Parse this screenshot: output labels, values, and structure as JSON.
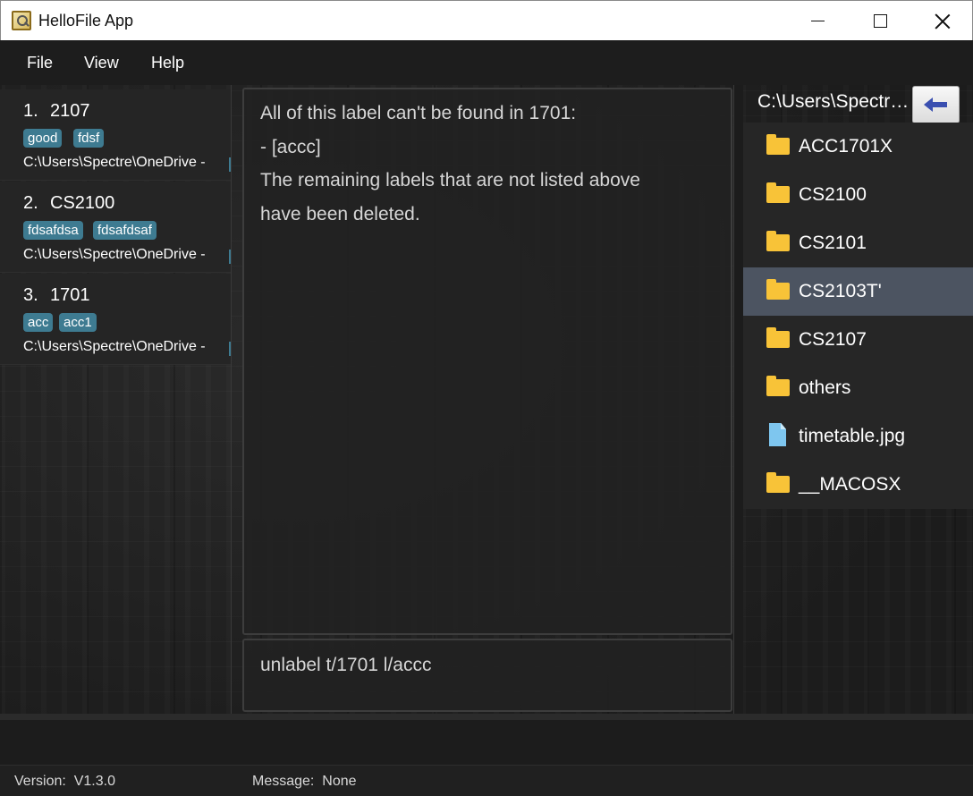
{
  "window": {
    "title": "HelloFile App"
  },
  "menu": {
    "file": "File",
    "view": "View",
    "help": "Help"
  },
  "cards": [
    {
      "index": "1.",
      "name": "2107",
      "tags": [
        "good",
        "fdsf"
      ],
      "path": "C:\\Users\\Spectre\\OneDrive -"
    },
    {
      "index": "2.",
      "name": "CS2100",
      "tags": [
        "fdsafdsa",
        "fdsafdsaf"
      ],
      "path": "C:\\Users\\Spectre\\OneDrive -"
    },
    {
      "index": "3.",
      "name": "1701",
      "tags": [
        "acc",
        "acc1"
      ],
      "path": "C:\\Users\\Spectre\\OneDrive -"
    }
  ],
  "result": {
    "lines": [
      "All of this label can't be found in 1701:",
      "- [accc]",
      "The remaining labels that are not listed above",
      "have been deleted."
    ]
  },
  "command": {
    "text": "unlabel t/1701 l/accc"
  },
  "files": {
    "path": "C:\\Users\\Spectre\\OneDrive",
    "back_icon": "arrow-left-icon",
    "items": [
      {
        "name": "ACC1701X",
        "type": "folder"
      },
      {
        "name": "CS2100",
        "type": "folder"
      },
      {
        "name": "CS2101",
        "type": "folder"
      },
      {
        "name": "CS2103T'",
        "type": "folder",
        "selected": true
      },
      {
        "name": "CS2107",
        "type": "folder"
      },
      {
        "name": "others",
        "type": "folder"
      },
      {
        "name": "timetable.jpg",
        "type": "file"
      },
      {
        "name": "__MACOSX",
        "type": "folder"
      }
    ]
  },
  "status": {
    "version_label": "Version:",
    "version_value": "V1.3.0",
    "message_label": "Message:",
    "message_value": "None"
  },
  "colors": {
    "tag": "#3e7b91",
    "selected_row": "#4c5461",
    "folder": "#f8c338",
    "file": "#7ec6ef",
    "back_arrow": "#3a4fb0"
  }
}
